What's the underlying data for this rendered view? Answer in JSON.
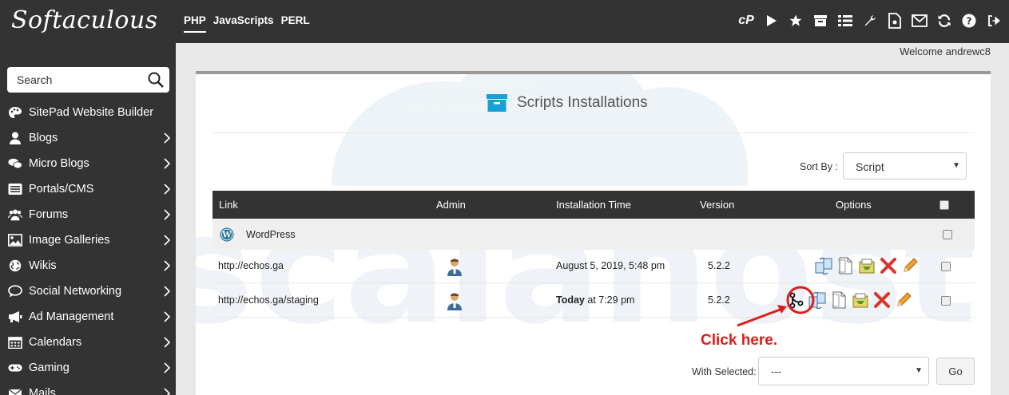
{
  "brand": {
    "logo_text": "Softaculous"
  },
  "topnav": [
    {
      "label": "PHP",
      "active": true
    },
    {
      "label": "JavaScripts",
      "active": false
    },
    {
      "label": "PERL",
      "active": false
    }
  ],
  "topicons": [
    "cpanel-icon",
    "play-icon",
    "star-icon",
    "archive-icon",
    "list-icon",
    "wrench-icon",
    "file-icon",
    "mail-icon",
    "refresh-icon",
    "help-icon",
    "logout-icon"
  ],
  "search": {
    "placeholder": "Search"
  },
  "sidebar": {
    "items": [
      {
        "label": "SitePad Website Builder",
        "icon": "palette-icon",
        "chevron": false
      },
      {
        "label": "Blogs",
        "icon": "user-icon",
        "chevron": true
      },
      {
        "label": "Micro Blogs",
        "icon": "chat-icon",
        "chevron": true
      },
      {
        "label": "Portals/CMS",
        "icon": "list-box-icon",
        "chevron": true
      },
      {
        "label": "Forums",
        "icon": "users-icon",
        "chevron": true
      },
      {
        "label": "Image Galleries",
        "icon": "image-icon",
        "chevron": true
      },
      {
        "label": "Wikis",
        "icon": "globe-icon",
        "chevron": true
      },
      {
        "label": "Social Networking",
        "icon": "comment-icon",
        "chevron": true
      },
      {
        "label": "Ad Management",
        "icon": "megaphone-icon",
        "chevron": true
      },
      {
        "label": "Calendars",
        "icon": "calendar-icon",
        "chevron": true
      },
      {
        "label": "Gaming",
        "icon": "gamepad-icon",
        "chevron": true
      },
      {
        "label": "Mails",
        "icon": "envelope-icon",
        "chevron": true
      }
    ]
  },
  "welcome": "Welcome andrewc8",
  "page": {
    "title": "Scripts Installations"
  },
  "sort": {
    "label": "Sort By :",
    "value": "Script"
  },
  "table": {
    "headers": {
      "link": "Link",
      "admin": "Admin",
      "time": "Installation Time",
      "version": "Version",
      "options": "Options"
    },
    "group": "WordPress",
    "rows": [
      {
        "link": "http://echos.ga",
        "time_bold": "",
        "time": "August 5, 2019, 5:48 pm",
        "version": "5.2.2"
      },
      {
        "link": "http://echos.ga/staging",
        "time_bold": "Today",
        "time": " at 7:29 pm",
        "version": "5.2.2"
      }
    ]
  },
  "annotation": {
    "text": "Click here.",
    "color": "#e01b1b"
  },
  "bulk": {
    "label": "With Selected:",
    "value": "---",
    "go": "Go"
  },
  "colors": {
    "dark": "#333333",
    "accent": "#1a9fd6",
    "delete": "#d9352a"
  }
}
